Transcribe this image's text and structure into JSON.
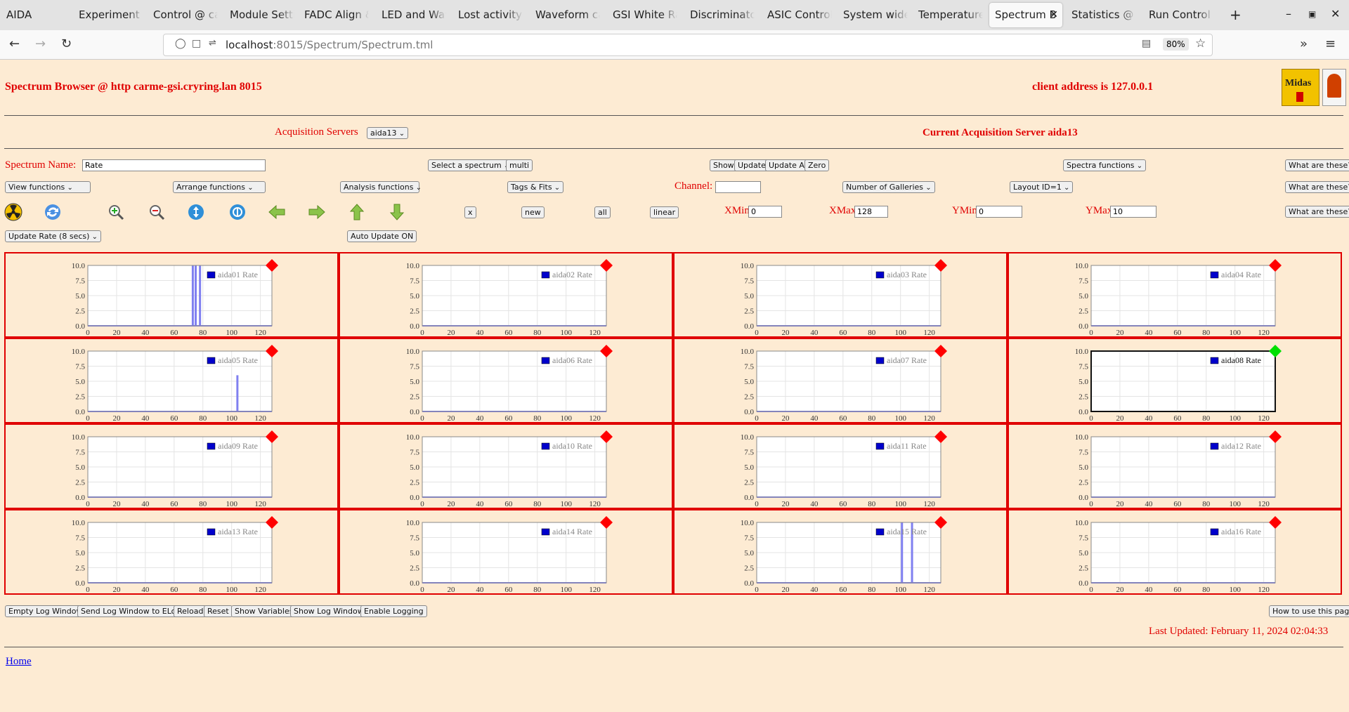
{
  "browser": {
    "app_name": "AIDA",
    "tabs": [
      {
        "label": "Experiment C",
        "active": false
      },
      {
        "label": "Control @ ca",
        "active": false
      },
      {
        "label": "Module Setti",
        "active": false
      },
      {
        "label": "FADC Align &",
        "active": false
      },
      {
        "label": "LED and Wav",
        "active": false
      },
      {
        "label": "Lost activity r",
        "active": false
      },
      {
        "label": "Waveform ca",
        "active": false
      },
      {
        "label": "GSI White Ra",
        "active": false
      },
      {
        "label": "Discriminator",
        "active": false
      },
      {
        "label": "ASIC Control",
        "active": false
      },
      {
        "label": "System wide",
        "active": false
      },
      {
        "label": "Temperature",
        "active": false
      },
      {
        "label": "Spectrum B",
        "active": true
      },
      {
        "label": "Statistics @ c",
        "active": false
      },
      {
        "label": "Run Control (",
        "active": false
      }
    ],
    "url_host": "localhost",
    "url_rest": ":8015/Spectrum/Spectrum.tml",
    "zoom": "80%"
  },
  "header": {
    "title": "Spectrum Browser @ http carme-gsi.cryring.lan 8015",
    "client": "client address is 127.0.0.1",
    "logo_text": "Midas"
  },
  "acq": {
    "label": "Acquisition Servers",
    "selected": "aida13",
    "current": "Current Acquisition Server aida13"
  },
  "controls": {
    "spectrum_name_label": "Spectrum Name:",
    "spectrum_name_value": "Rate",
    "select_spectrum": "Select a spectrum",
    "multi": "multi",
    "show": "Show",
    "update": "Update",
    "update_all": "Update All",
    "zero": "Zero",
    "spectra_functions": "Spectra functions",
    "what1": "What are these?",
    "view_functions": "View functions",
    "arrange_functions": "Arrange functions",
    "analysis_functions": "Analysis functions",
    "tags_fits": "Tags & Fits",
    "channel_label": "Channel:",
    "channel_value": "",
    "number_of_galleries": "Number of Galleries",
    "layout": "Layout ID=1",
    "what2": "What are these?",
    "x": "x",
    "new": "new",
    "all": "all",
    "linear": "linear",
    "xmin_label": "XMin",
    "xmin": "0",
    "xmax_label": "XMax",
    "xmax": "128",
    "ymin_label": "YMin",
    "ymin": "0",
    "ymax_label": "YMax",
    "ymax": "10",
    "what3": "What are these?",
    "update_rate": "Update Rate (8 secs)",
    "auto_update": "Auto Update ON"
  },
  "icons": [
    "radiation-icon",
    "refresh-icon",
    "zoom-in-icon",
    "zoom-out-icon",
    "expand-vertical-icon",
    "expand-horizontal-icon",
    "arrow-left-icon",
    "arrow-right-icon",
    "arrow-up-icon",
    "arrow-down-icon"
  ],
  "colors": {
    "accent": "#e00000",
    "bar": "#8080f0",
    "status_red": "#ff0000",
    "status_green": "#00e000"
  },
  "chart_data": {
    "type": "bar",
    "xlim": [
      0,
      128
    ],
    "ylim": [
      0,
      10
    ],
    "xticks": [
      "0",
      "20",
      "40",
      "60",
      "80",
      "100",
      "120"
    ],
    "yticks": [
      "0.0",
      "2.5",
      "5.0",
      "7.5",
      "10.0"
    ],
    "grid": true,
    "panels": [
      {
        "legend": "aida01 Rate",
        "status": "red",
        "bars": [
          [
            73,
            10
          ],
          [
            75,
            10
          ],
          [
            78,
            10
          ]
        ]
      },
      {
        "legend": "aida02 Rate",
        "status": "red",
        "bars": []
      },
      {
        "legend": "aida03 Rate",
        "status": "red",
        "bars": []
      },
      {
        "legend": "aida04 Rate",
        "status": "red",
        "bars": []
      },
      {
        "legend": "aida05 Rate",
        "status": "red",
        "bars": [
          [
            104,
            6
          ]
        ]
      },
      {
        "legend": "aida06 Rate",
        "status": "red",
        "bars": []
      },
      {
        "legend": "aida07 Rate",
        "status": "red",
        "bars": []
      },
      {
        "legend": "aida08 Rate",
        "status": "green",
        "bars": []
      },
      {
        "legend": "aida09 Rate",
        "status": "red",
        "bars": []
      },
      {
        "legend": "aida10 Rate",
        "status": "red",
        "bars": []
      },
      {
        "legend": "aida11 Rate",
        "status": "red",
        "bars": []
      },
      {
        "legend": "aida12 Rate",
        "status": "red",
        "bars": []
      },
      {
        "legend": "aida13 Rate",
        "status": "red",
        "bars": []
      },
      {
        "legend": "aida14 Rate",
        "status": "red",
        "bars": []
      },
      {
        "legend": "aida15 Rate",
        "status": "red",
        "bars": [
          [
            101,
            10
          ],
          [
            108,
            10
          ]
        ]
      },
      {
        "legend": "aida16 Rate",
        "status": "red",
        "bars": []
      }
    ]
  },
  "footer": {
    "empty_log": "Empty Log Window",
    "send_log": "Send Log Window to ELog",
    "reload": "Reload",
    "reset": "Reset",
    "show_variables": "Show Variables",
    "show_log": "Show Log Window",
    "enable_logging": "Enable Logging",
    "how_to": "How to use this page",
    "last_updated": "Last Updated: February 11, 2024 02:04:33",
    "home": "Home"
  }
}
